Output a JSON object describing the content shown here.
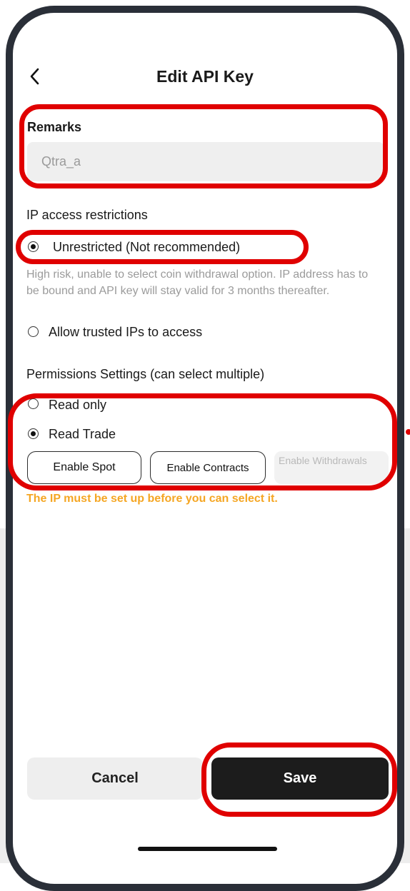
{
  "header": {
    "title": "Edit API Key"
  },
  "remarks": {
    "label": "Remarks",
    "value": "Qtra_a"
  },
  "ip_access": {
    "heading": "IP access restrictions",
    "options": [
      {
        "label": "Unrestricted (Not recommended)",
        "selected": true
      },
      {
        "label": "Allow trusted IPs to access",
        "selected": false
      }
    ],
    "help_text": "High risk, unable to select coin withdrawal option. IP address has to be bound and API key will stay valid for 3 months thereafter."
  },
  "permissions": {
    "heading": "Permissions Settings (can select multiple)",
    "options": [
      {
        "label": "Read only",
        "selected": false
      },
      {
        "label": "Read Trade",
        "selected": true
      }
    ],
    "buttons": {
      "spot": "Enable Spot",
      "contracts": "Enable Contracts",
      "withdrawals": "Enable Withdrawals"
    },
    "warning": "The IP must be set up before you can select it."
  },
  "footer": {
    "cancel_label": "Cancel",
    "save_label": "Save"
  },
  "colors": {
    "annotation": "#e00000",
    "warning": "#f5a623",
    "primary_button": "#1c1c1c"
  }
}
